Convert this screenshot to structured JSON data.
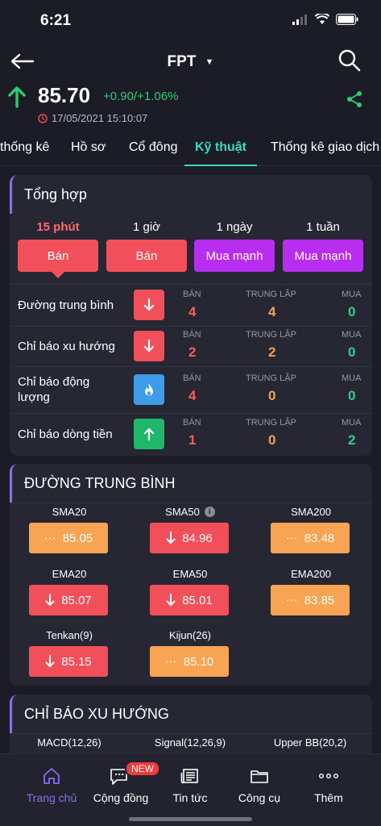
{
  "status": {
    "time": "6:21"
  },
  "header": {
    "ticker": "FPT"
  },
  "price": {
    "value": "85.70",
    "change": "+0.90/+1.06%",
    "time": "17/05/2021 15:10:07"
  },
  "tabs": [
    "thống kê",
    "Hồ sơ",
    "Cổ đông",
    "Kỹ thuật",
    "Thống kê giao dịch"
  ],
  "summary": {
    "title": "Tổng hợp",
    "periods": [
      {
        "label": "15 phút",
        "signal": "Bán",
        "active": true
      },
      {
        "label": "1 giờ",
        "signal": "Bán"
      },
      {
        "label": "1 ngày",
        "signal": "Mua mạnh"
      },
      {
        "label": "1 tuần",
        "signal": "Mua mạnh"
      }
    ],
    "col_sell": "BÁN",
    "col_neutral": "TRUNG LẬP",
    "col_buy": "MUA",
    "indicators": [
      {
        "label": "Đường trung bình",
        "trend": "down",
        "sell": "4",
        "neutral": "4",
        "buy": "0"
      },
      {
        "label": "Chỉ báo xu hướng",
        "trend": "down",
        "sell": "2",
        "neutral": "2",
        "buy": "0"
      },
      {
        "label": "Chỉ báo động lượng",
        "trend": "neutral",
        "sell": "4",
        "neutral": "0",
        "buy": "0"
      },
      {
        "label": "Chỉ báo dòng tiền",
        "trend": "up",
        "sell": "1",
        "neutral": "0",
        "buy": "2"
      }
    ]
  },
  "moving_average": {
    "title": "ĐƯỜNG TRUNG BÌNH",
    "items": [
      {
        "name": "SMA20",
        "value": "85.05",
        "trend": "neutral"
      },
      {
        "name": "SMA50",
        "value": "84.96",
        "trend": "down",
        "info": true
      },
      {
        "name": "SMA200",
        "value": "83.48",
        "trend": "neutral"
      },
      {
        "name": "EMA20",
        "value": "85.07",
        "trend": "down"
      },
      {
        "name": "EMA50",
        "value": "85.01",
        "trend": "down"
      },
      {
        "name": "EMA200",
        "value": "83.85",
        "trend": "neutral"
      },
      {
        "name": "Tenkan(9)",
        "value": "85.15",
        "trend": "down"
      },
      {
        "name": "Kijun(26)",
        "value": "85.10",
        "trend": "neutral"
      }
    ]
  },
  "trend_indicators": {
    "title": "CHỈ BÁO XU HƯỚNG",
    "columns": [
      "MACD(12,26)",
      "Signal(12,26,9)",
      "Upper BB(20,2)"
    ]
  },
  "bottom_nav": {
    "items": [
      "Trang chủ",
      "Cộng đồng",
      "Tin tức",
      "Công cụ",
      "Thêm"
    ],
    "new_badge": "NEW"
  },
  "colors": {
    "accent": "#8c6df0",
    "tab_active": "#3fd8bf",
    "sell": "#f1505a",
    "strong_buy": "#b82ef0",
    "neutral": "#f8a452",
    "up": "#2ecc71"
  }
}
